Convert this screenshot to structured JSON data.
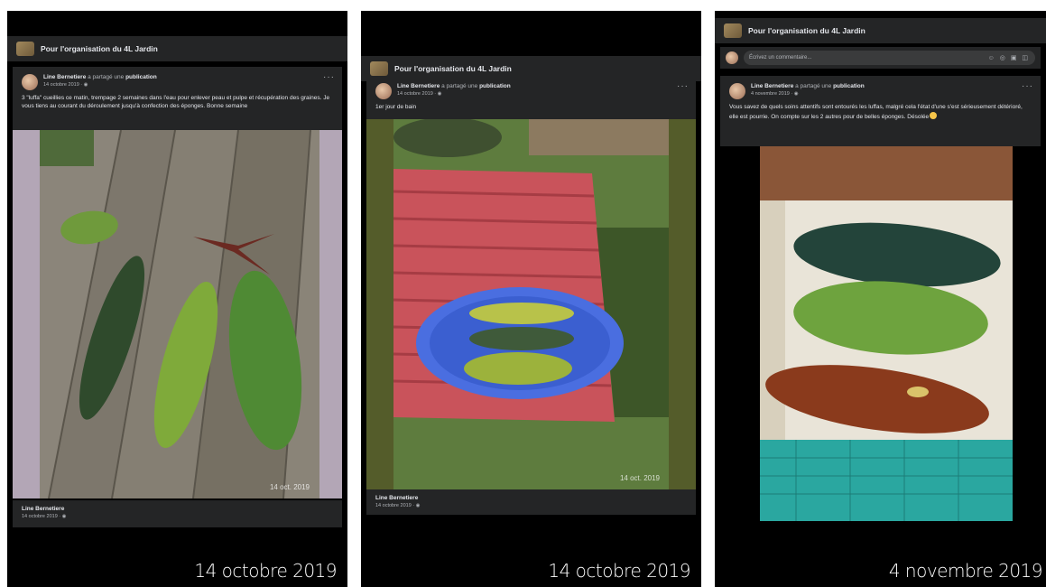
{
  "group_name": "Pour l'organisation du 4L Jardin",
  "posts": [
    {
      "author": "Line Bernetiere",
      "shared_text": "a partagé une",
      "shared_target": "publication",
      "date": "14 octobre 2019",
      "caption": "3 \"luffa\" cueillies ce matin, trempage 2 semaines dans l'eau pour enlever peau et pulpe et récupération des graines. Je vous tiens au courant du déroulement jusqu'à confection des éponges. Bonne semaine",
      "photo_stamp": "14 oct. 2019",
      "footer_author": "Line Bernetiere",
      "footer_date": "14 octobre 2019",
      "big_date": "14 octobre 2019"
    },
    {
      "author": "Line Bernetiere",
      "shared_text": "a partagé une",
      "shared_target": "publication",
      "date": "14 octobre 2019",
      "caption": "1er jour de bain",
      "photo_stamp": "14 oct. 2019",
      "footer_author": "Line Bernetiere",
      "footer_date": "14 octobre 2019",
      "big_date": "14 octobre 2019"
    },
    {
      "author": "Line Bernetiere",
      "shared_text": "a partagé une",
      "shared_target": "publication",
      "date": "4 novembre 2019",
      "caption": "Vous savez de quels soins attentifs sont entourés les luffas, malgré cela l'état d'une s'est sérieusement détérioré, elle est pourrie. On compte sur les 2 autres pour de belles éponges. Désolée",
      "comment_placeholder": "Écrivez un commentaire...",
      "big_date": "4 novembre 2019"
    }
  ],
  "icons": {
    "more": "more-options-icon",
    "globe": "globe-icon",
    "emoji": "sad-emoji-icon"
  }
}
